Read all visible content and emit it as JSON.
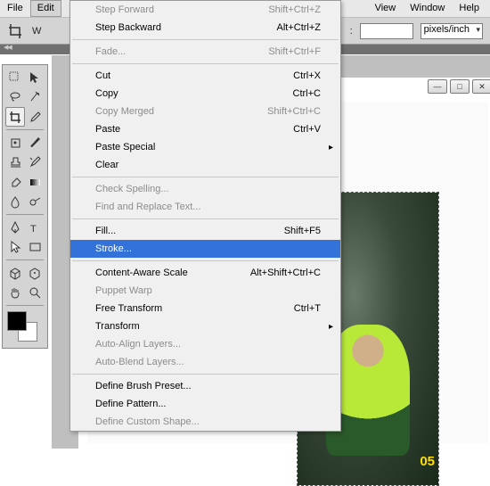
{
  "menubar": {
    "file": "File",
    "edit": "Edit",
    "view": "View",
    "window": "Window",
    "help": "Help"
  },
  "optbar": {
    "w_prefix": "W",
    "unit": "pixels/inch",
    "res_prefix": ":"
  },
  "winbtns": {
    "min": "—",
    "max": "□",
    "close": "✕"
  },
  "photo_txt": "05",
  "edit_menu": [
    {
      "label": "Step Forward",
      "shortcut": "Shift+Ctrl+Z",
      "type": "item",
      "dis": true
    },
    {
      "label": "Step Backward",
      "shortcut": "Alt+Ctrl+Z",
      "type": "item"
    },
    {
      "type": "sep"
    },
    {
      "label": "Fade...",
      "shortcut": "Shift+Ctrl+F",
      "type": "item",
      "dis": true
    },
    {
      "type": "sep"
    },
    {
      "label": "Cut",
      "shortcut": "Ctrl+X",
      "type": "item"
    },
    {
      "label": "Copy",
      "shortcut": "Ctrl+C",
      "type": "item"
    },
    {
      "label": "Copy Merged",
      "shortcut": "Shift+Ctrl+C",
      "type": "item",
      "dis": true
    },
    {
      "label": "Paste",
      "shortcut": "Ctrl+V",
      "type": "item"
    },
    {
      "label": "Paste Special",
      "shortcut": "",
      "type": "submenu"
    },
    {
      "label": "Clear",
      "shortcut": "",
      "type": "item"
    },
    {
      "type": "sep"
    },
    {
      "label": "Check Spelling...",
      "shortcut": "",
      "type": "item",
      "dis": true
    },
    {
      "label": "Find and Replace Text...",
      "shortcut": "",
      "type": "item",
      "dis": true
    },
    {
      "type": "sep"
    },
    {
      "label": "Fill...",
      "shortcut": "Shift+F5",
      "type": "item"
    },
    {
      "label": "Stroke...",
      "shortcut": "",
      "type": "item",
      "hl": true
    },
    {
      "type": "sep"
    },
    {
      "label": "Content-Aware Scale",
      "shortcut": "Alt+Shift+Ctrl+C",
      "type": "item"
    },
    {
      "label": "Puppet Warp",
      "shortcut": "",
      "type": "item",
      "dis": true
    },
    {
      "label": "Free Transform",
      "shortcut": "Ctrl+T",
      "type": "item"
    },
    {
      "label": "Transform",
      "shortcut": "",
      "type": "submenu"
    },
    {
      "label": "Auto-Align Layers...",
      "shortcut": "",
      "type": "item",
      "dis": true
    },
    {
      "label": "Auto-Blend Layers...",
      "shortcut": "",
      "type": "item",
      "dis": true
    },
    {
      "type": "sep"
    },
    {
      "label": "Define Brush Preset...",
      "shortcut": "",
      "type": "item"
    },
    {
      "label": "Define Pattern...",
      "shortcut": "",
      "type": "item"
    },
    {
      "label": "Define Custom Shape...",
      "shortcut": "",
      "type": "item",
      "dis": true
    }
  ]
}
